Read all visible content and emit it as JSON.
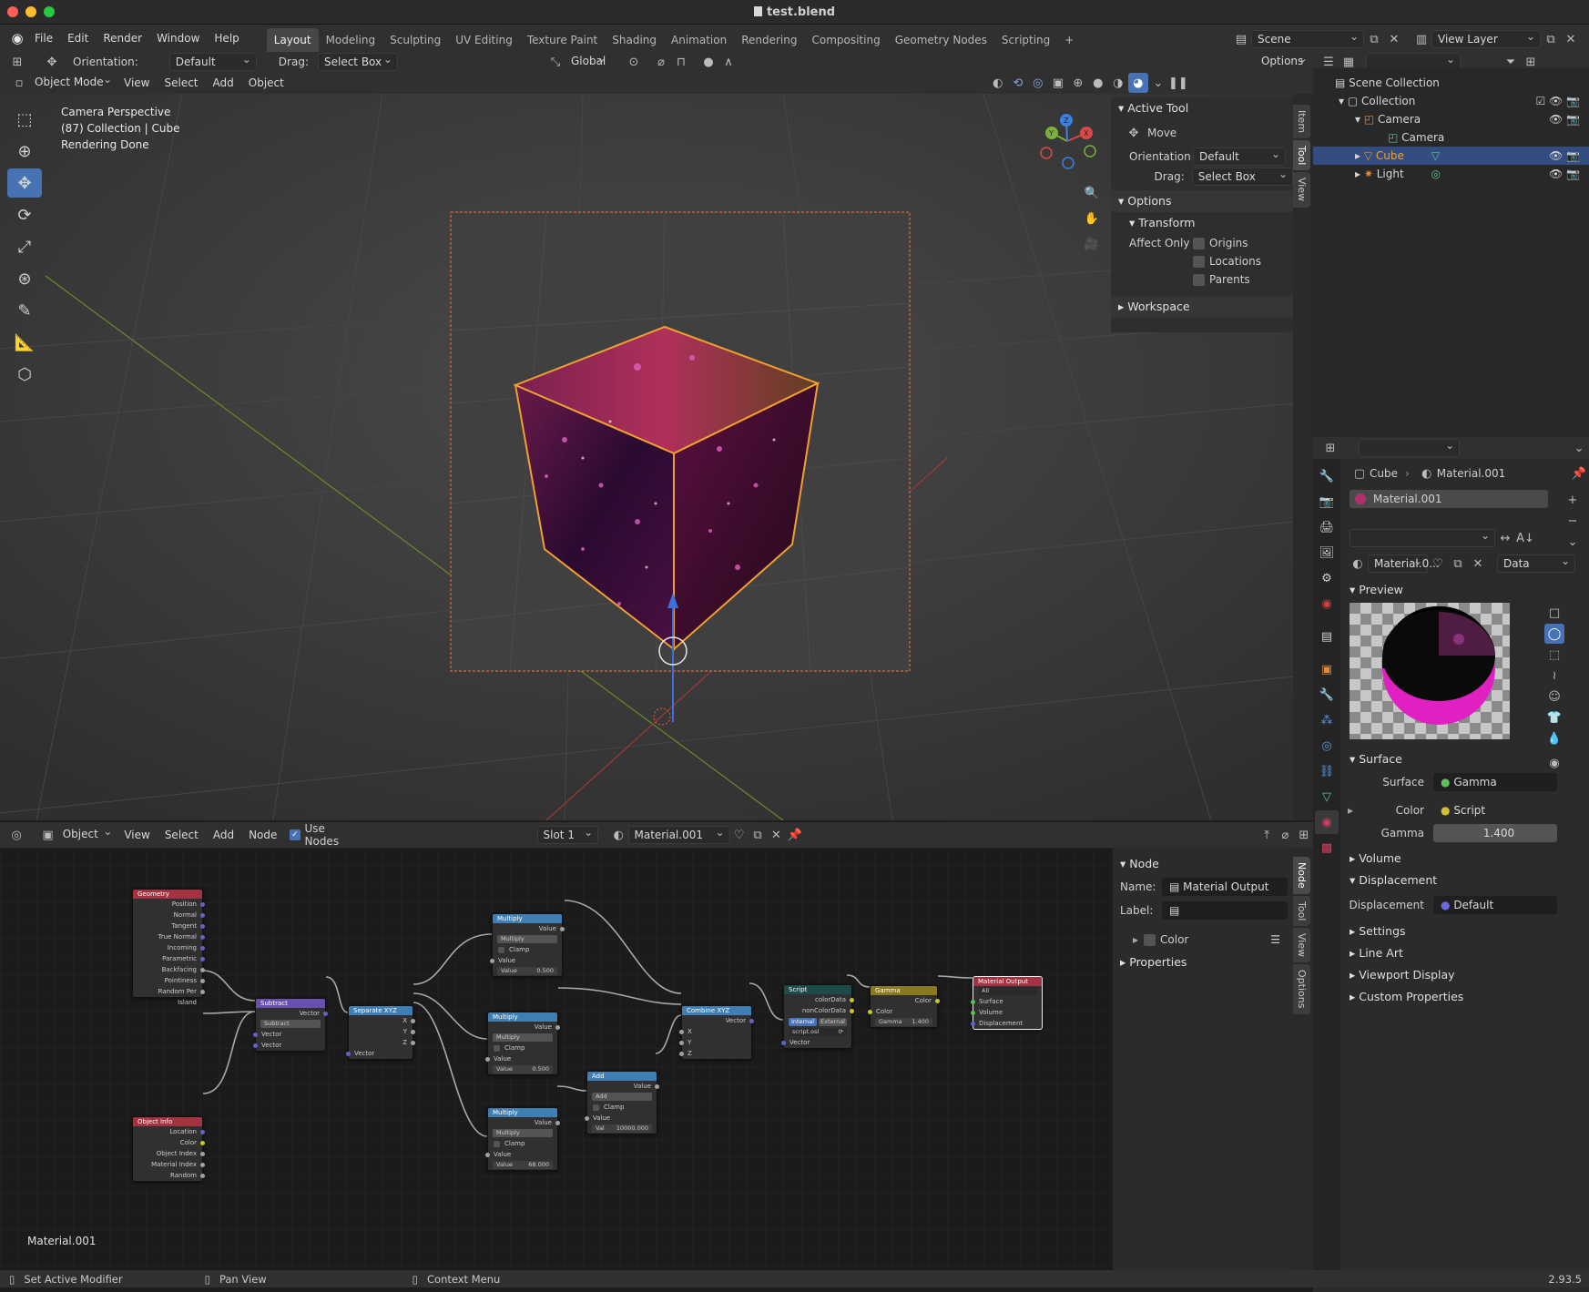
{
  "window": {
    "title": "test.blend"
  },
  "menu": [
    "File",
    "Edit",
    "Render",
    "Window",
    "Help"
  ],
  "workspaces": [
    "Layout",
    "Modeling",
    "Sculpting",
    "UV Editing",
    "Texture Paint",
    "Shading",
    "Animation",
    "Rendering",
    "Compositing",
    "Geometry Nodes",
    "Scripting"
  ],
  "scene": {
    "scene_name": "Scene",
    "view_layer": "View Layer"
  },
  "tool_header": {
    "orientation_label": "Orientation:",
    "orientation_value": "Default",
    "drag_label": "Drag:",
    "drag_value": "Select Box",
    "transform": "Global",
    "options": "Options"
  },
  "viewport_header": {
    "mode": "Object Mode",
    "items": [
      "View",
      "Select",
      "Add",
      "Object"
    ]
  },
  "viewport_overlay": {
    "line1": "Camera Perspective",
    "line2": "(87) Collection | Cube",
    "line3": "Rendering Done"
  },
  "gizmo": {
    "x": "X",
    "y": "Y",
    "z": "Z"
  },
  "npanel": {
    "active_tool": "Active Tool",
    "move": "Move",
    "orientation_label": "Orientation",
    "orientation_value": "Default",
    "drag_label": "Drag:",
    "drag_value": "Select Box",
    "options": "Options",
    "transform": "Transform",
    "affect_only": "Affect Only",
    "origins": "Origins",
    "locations": "Locations",
    "parents": "Parents",
    "workspace": "Workspace",
    "tabs": [
      "Item",
      "Tool",
      "View"
    ]
  },
  "outliner": {
    "items": [
      {
        "label": "Scene Collection"
      },
      {
        "label": "Collection"
      },
      {
        "label": "Camera"
      },
      {
        "label": "Camera"
      },
      {
        "label": "Cube"
      },
      {
        "label": "Light"
      }
    ]
  },
  "properties": {
    "breadcrumb_object": "Cube",
    "breadcrumb_material": "Material.001",
    "slot": "Material.001",
    "material_short": "Material.0...",
    "link": "Data",
    "preview": "Preview",
    "surface_section": "Surface",
    "surface_label": "Surface",
    "surface_value": "Gamma",
    "color_label": "Color",
    "color_value": "Script",
    "gamma_label": "Gamma",
    "gamma_value": "1.400",
    "volume": "Volume",
    "displacement_section": "Displacement",
    "displacement_label": "Displacement",
    "displacement_value": "Default",
    "settings": "Settings",
    "line_art": "Line Art",
    "viewport_display": "Viewport Display",
    "custom_properties": "Custom Properties"
  },
  "node_header": {
    "type": "Object",
    "items": [
      "View",
      "Select",
      "Add",
      "Node"
    ],
    "use_nodes": "Use Nodes",
    "slot": "Slot 1",
    "material": "Material.001"
  },
  "node_panel": {
    "node": "Node",
    "name_label": "Name:",
    "name_value": "Material Output",
    "label_label": "Label:",
    "color": "Color",
    "properties": "Properties",
    "tabs": [
      "Node",
      "Tool",
      "View",
      "Options"
    ]
  },
  "node_editor_label": "Material.001",
  "nodes": {
    "geometry": {
      "title": "Geometry",
      "outputs": [
        "Position",
        "Normal",
        "Tangent",
        "True Normal",
        "Incoming",
        "Parametric",
        "Backfacing",
        "Pointiness",
        "Random Per Island"
      ]
    },
    "object_info": {
      "title": "Object Info",
      "outputs": [
        "Location",
        "Color",
        "Object Index",
        "Material Index",
        "Random"
      ]
    },
    "subtract": {
      "title": "Subtract",
      "out": "Vector",
      "op": "Subtract",
      "in1": "Vector",
      "in2": "Vector"
    },
    "separate": {
      "title": "Separate XYZ",
      "x": "X",
      "y": "Y",
      "z": "Z",
      "in": "Vector"
    },
    "mult1": {
      "title": "Multiply",
      "out": "Value",
      "op": "Multiply",
      "clamp": "Clamp",
      "in": "Value",
      "val_label": "Value",
      "val": "0.500"
    },
    "mult2": {
      "title": "Multiply",
      "out": "Value",
      "op": "Multiply",
      "clamp": "Clamp",
      "in": "Value",
      "val_label": "Value",
      "val": "0.500"
    },
    "mult3": {
      "title": "Multiply",
      "out": "Value",
      "op": "Multiply",
      "clamp": "Clamp",
      "in": "Value",
      "val_label": "Value",
      "val": "68.000"
    },
    "add": {
      "title": "Add",
      "out": "Value",
      "op": "Add",
      "clamp": "Clamp",
      "in": "Value",
      "val_label": "Val",
      "val": "10000.000"
    },
    "combine": {
      "title": "Combine XYZ",
      "out": "Vector",
      "x": "X",
      "y": "Y",
      "z": "Z"
    },
    "script": {
      "title": "Script",
      "o1": "colorData",
      "o2": "nonColorData",
      "internal": "Internal",
      "external": "External",
      "file": "script.osl",
      "in": "Vector"
    },
    "gamma": {
      "title": "Gamma",
      "out": "Color",
      "in": "Color",
      "gamma_label": "Gamma",
      "gamma": "1.400"
    },
    "output": {
      "title": "Material Output",
      "target": "All",
      "in1": "Surface",
      "in2": "Volume",
      "in3": "Displacement"
    }
  },
  "statusbar": {
    "left": "Set Active Modifier",
    "mid": "Pan View",
    "right": "Context Menu",
    "version": "2.93.5"
  },
  "colors": {
    "accent": "#4772b3",
    "selected_orange": "#f0a030",
    "geometry_header": "#a33340",
    "math_header": "#3f7fb3",
    "vector_header": "#6a4fb0",
    "script_header": "#1f4a4a",
    "gamma_header": "#8a7a1f",
    "output_header": "#a33340"
  }
}
